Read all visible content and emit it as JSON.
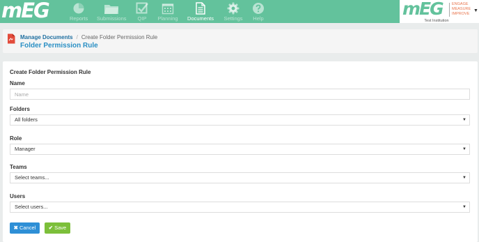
{
  "app": {
    "logo_text": "mEG"
  },
  "nav": {
    "items": [
      {
        "label": "Reports",
        "icon": "pie-chart-icon"
      },
      {
        "label": "Submissions",
        "icon": "folder-icon"
      },
      {
        "label": "QIP",
        "icon": "checkbox-icon"
      },
      {
        "label": "Planning",
        "icon": "calendar-icon"
      },
      {
        "label": "Documents",
        "icon": "document-icon",
        "active": true
      },
      {
        "label": "Settings",
        "icon": "gear-icon"
      },
      {
        "label": "Help",
        "icon": "help-icon"
      }
    ]
  },
  "institution": {
    "logo_text": "mEG",
    "tagline_1": "ENGAGE",
    "tagline_2": "MEASURE",
    "tagline_3": "IMPROVE",
    "name": "Test Institution"
  },
  "header": {
    "breadcrumb_link": "Manage Documents",
    "breadcrumb_sep": "/",
    "breadcrumb_current": "Create Folder Permission Rule",
    "title": "Folder Permission Rule"
  },
  "form": {
    "title": "Create Folder Permission Rule",
    "name_label": "Name",
    "name_placeholder": "Name",
    "folders_label": "Folders",
    "folders_value": "All folders",
    "role_label": "Role",
    "role_value": "Manager",
    "teams_label": "Teams",
    "teams_value": "Select teams...",
    "users_label": "Users",
    "users_value": "Select users...",
    "cancel_label": "Cancel",
    "save_label": "Save"
  },
  "colors": {
    "nav_bg": "#63c29c",
    "title_blue": "#2a8fc4",
    "cancel_blue": "#2e8fd6",
    "save_green": "#7cbf3a",
    "tagline_orange": "#e8744c"
  }
}
